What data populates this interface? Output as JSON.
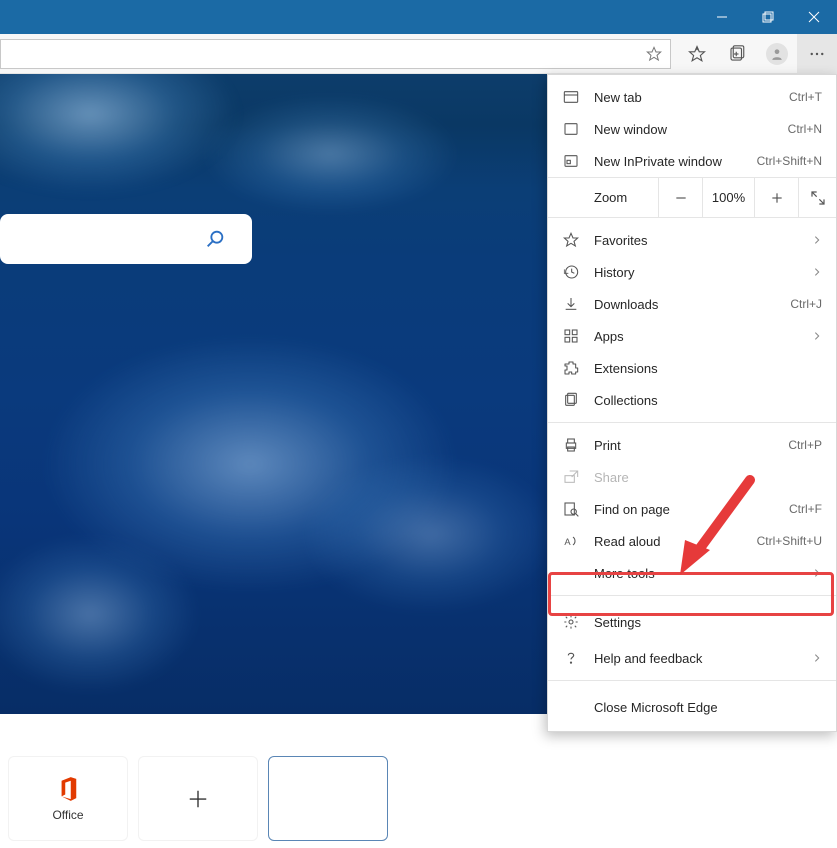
{
  "window": {
    "minimize": "Minimize",
    "maximize": "Restore",
    "close": "Close"
  },
  "toolbar": {
    "favorite_star": "Add to favorites",
    "favorites": "Favorites",
    "collections": "Collections",
    "profile": "Profile",
    "more": "Settings and more"
  },
  "search": {
    "placeholder": ""
  },
  "tiles": {
    "office": {
      "label": "Office"
    },
    "add": {
      "label": ""
    }
  },
  "menu": {
    "new_tab": {
      "label": "New tab",
      "shortcut": "Ctrl+T"
    },
    "new_window": {
      "label": "New window",
      "shortcut": "Ctrl+N"
    },
    "new_inprivate": {
      "label": "New InPrivate window",
      "shortcut": "Ctrl+Shift+N"
    },
    "zoom": {
      "label": "Zoom",
      "value": "100%"
    },
    "favorites": {
      "label": "Favorites"
    },
    "history": {
      "label": "History"
    },
    "downloads": {
      "label": "Downloads",
      "shortcut": "Ctrl+J"
    },
    "apps": {
      "label": "Apps"
    },
    "extensions": {
      "label": "Extensions"
    },
    "collections": {
      "label": "Collections"
    },
    "print": {
      "label": "Print",
      "shortcut": "Ctrl+P"
    },
    "share": {
      "label": "Share"
    },
    "find": {
      "label": "Find on page",
      "shortcut": "Ctrl+F"
    },
    "read_aloud": {
      "label": "Read aloud",
      "shortcut": "Ctrl+Shift+U"
    },
    "more_tools": {
      "label": "More tools"
    },
    "settings": {
      "label": "Settings"
    },
    "help": {
      "label": "Help and feedback"
    },
    "close": {
      "label": "Close Microsoft Edge"
    }
  }
}
